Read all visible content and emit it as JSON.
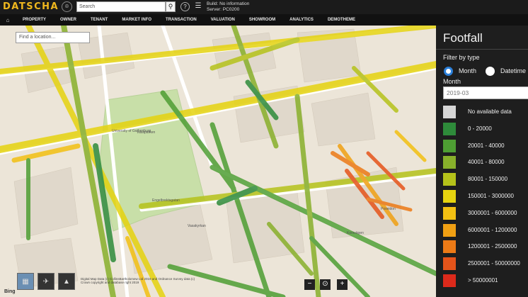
{
  "header": {
    "logo": "DATSCHA",
    "search_placeholder": "Search",
    "build_line1": "Build: No information",
    "build_line2": "Server: PC0200"
  },
  "nav": {
    "items": [
      "PROPERTY",
      "OWNER",
      "TENANT",
      "MARKET INFO",
      "TRANSACTION",
      "VALUATION",
      "SHOWROOM",
      "ANALYTICS",
      "DEMOTHEME"
    ]
  },
  "map": {
    "find_placeholder": "Find a location...",
    "copyright_line1": "Digital Map Data (c) CollinsBartholomew Ltd 2019 and Ordnance Survey data (c)",
    "copyright_line2": "Crown copyright and database right 2019",
    "bing": "Bing",
    "labels": {
      "university": "University of Gothenburg",
      "vasaparken": "Vasaparken",
      "engelbrektsgatan": "Engelbrektsgatan",
      "vasakyrkan": "Vasakyrkan",
      "korsvagen": "Korsvägen",
      "poseidon": "Poseidon"
    },
    "controls": {
      "zoom_out": "−",
      "zoom_reset": "⊙",
      "zoom_in": "+"
    }
  },
  "panel": {
    "title": "Footfall",
    "filter_label": "Filter by type",
    "radio_month": "Month",
    "radio_datetime": "Datetime",
    "month_label": "Month",
    "month_value": "2019-03",
    "legend": [
      {
        "label": "No available data",
        "color": "#d6d6d6"
      },
      {
        "label": "0 - 20000",
        "color": "#2e8b3a"
      },
      {
        "label": "20001 - 40000",
        "color": "#4e9e33"
      },
      {
        "label": "40001 - 80000",
        "color": "#88b02b"
      },
      {
        "label": "80001 - 150000",
        "color": "#b5c21a"
      },
      {
        "label": "150001 - 3000000",
        "color": "#e5d30f"
      },
      {
        "label": "3000001 - 6000000",
        "color": "#f2c012"
      },
      {
        "label": "6000001 - 1200000",
        "color": "#f0a013"
      },
      {
        "label": "1200001 - 2500000",
        "color": "#ec7a16"
      },
      {
        "label": "2500001 - 50000000",
        "color": "#e5541a"
      },
      {
        "label": "> 50000001",
        "color": "#dd2a1b"
      }
    ]
  }
}
